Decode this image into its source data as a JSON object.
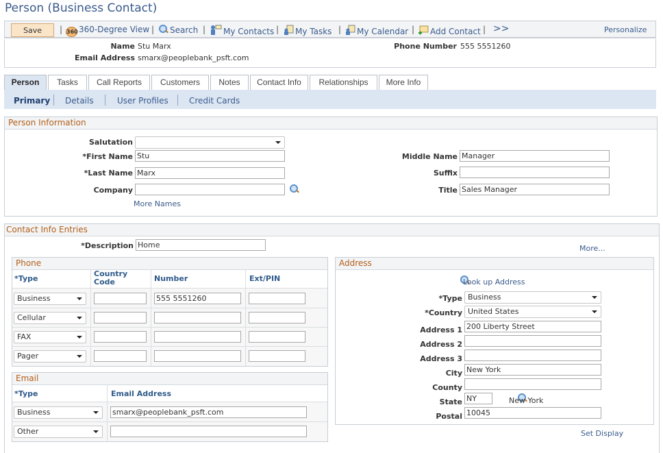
{
  "page": {
    "title": "Person (Business Contact)"
  },
  "toolbar": {
    "save_label": "Save",
    "items": [
      {
        "label": "360-Degree View",
        "icon": "360-icon"
      },
      {
        "label": "Search",
        "icon": "search-icon"
      },
      {
        "label": "My Contacts",
        "icon": "contacts-icon"
      },
      {
        "label": "My Tasks",
        "icon": "tasks-icon"
      },
      {
        "label": "My Calendar",
        "icon": "calendar-icon"
      },
      {
        "label": "Add Contact",
        "icon": "add-contact-icon"
      }
    ],
    "more_label": ">>",
    "separator": "|",
    "personalize_label": "Personalize"
  },
  "summary": {
    "name_label": "Name",
    "name_value": "Stu Marx",
    "email_label": "Email Address",
    "email_value": "smarx@peoplebank_psft.com",
    "phone_label": "Phone Number",
    "phone_value": "555 5551260"
  },
  "tabs": [
    {
      "label": "Person",
      "active": true
    },
    {
      "label": "Tasks"
    },
    {
      "label": "Call Reports"
    },
    {
      "label": "Customers"
    },
    {
      "label": "Notes"
    },
    {
      "label": "Contact Info"
    },
    {
      "label": "Relationships"
    },
    {
      "label": "More Info"
    }
  ],
  "subnav": [
    {
      "label": "Primary",
      "active": true
    },
    {
      "label": "Details"
    },
    {
      "label": "User Profiles"
    },
    {
      "label": "Credit Cards"
    }
  ],
  "person_info": {
    "header": "Person Information",
    "salutation_label": "Salutation",
    "salutation_value": "",
    "first_name_label": "*First Name",
    "first_name_value": "Stu",
    "last_name_label": "*Last Name",
    "last_name_value": "Marx",
    "company_label": "Company",
    "company_value": "",
    "more_names_label": "More Names",
    "middle_name_label": "Middle Name",
    "middle_name_value": "Manager",
    "suffix_label": "Suffix",
    "suffix_value": "",
    "title_label": "Title",
    "title_value": "Sales Manager"
  },
  "contact_entries": {
    "header": "Contact Info Entries",
    "description_label": "*Description",
    "description_value": "Home",
    "more_label": "More...",
    "phone": {
      "header": "Phone",
      "columns": [
        "*Type",
        "Country Code",
        "Number",
        "Ext/PIN"
      ],
      "rows": [
        {
          "type": "Business",
          "country_code": "",
          "number": "555 5551260",
          "ext": ""
        },
        {
          "type": "Cellular",
          "country_code": "",
          "number": "",
          "ext": ""
        },
        {
          "type": "FAX",
          "country_code": "",
          "number": "",
          "ext": ""
        },
        {
          "type": "Pager",
          "country_code": "",
          "number": "",
          "ext": ""
        }
      ]
    },
    "email": {
      "header": "Email",
      "columns": [
        "*Type",
        "Email Address"
      ],
      "rows": [
        {
          "type": "Business",
          "address": "smarx@peoplebank_psft.com"
        },
        {
          "type": "Other",
          "address": ""
        }
      ]
    },
    "address": {
      "header": "Address",
      "lookup_label": "Look up Address",
      "type_label": "*Type",
      "type_value": "Business",
      "country_label": "*Country",
      "country_value": "United States",
      "address1_label": "Address 1",
      "address1_value": "200 Liberty Street",
      "address2_label": "Address 2",
      "address2_value": "",
      "address3_label": "Address 3",
      "address3_value": "",
      "city_label": "City",
      "city_value": "New York",
      "county_label": "County",
      "county_value": "",
      "state_label": "State",
      "state_value": "NY",
      "state_name": "New York",
      "postal_label": "Postal",
      "postal_value": "10045"
    },
    "set_display_label": "Set Display"
  }
}
